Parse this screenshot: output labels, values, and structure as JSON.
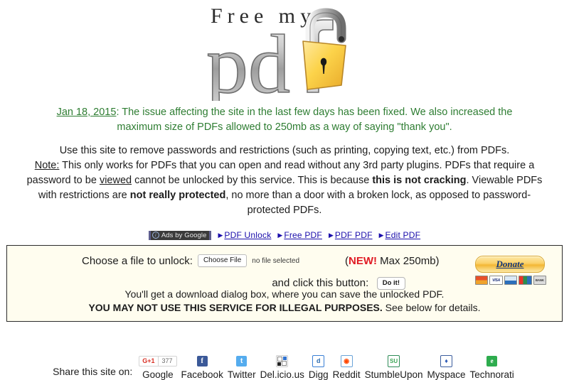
{
  "logo": {
    "line1": "Free my",
    "line2": "pdf",
    "lock_icon": "open-padlock-icon"
  },
  "news": {
    "date": "Jan 18, 2015",
    "text": ": The issue affecting the site in the last few days has been fixed. We also increased the maximum size of PDFs allowed to 250mb as a way of saying \"thank you\".",
    "color": "#2e7d32"
  },
  "intro": {
    "line1": "Use this site to remove passwords and restrictions (such as printing, copying text, etc.) from PDFs.",
    "note_label": "Note:",
    "p2_a": " This only works for PDFs that you can open and read without any 3rd party plugins. PDFs that require a password to be ",
    "p2_viewed": "viewed",
    "p2_b": " cannot be unlocked by this service. This is because ",
    "p2_bold1": "this is not cracking",
    "p2_c": ". Viewable PDFs with restrictions are ",
    "p2_bold2": "not really protected",
    "p2_d": ", no more than a door with a broken lock, as opposed to password-protected PDFs."
  },
  "adbar": {
    "badge_label": "Ads by Google",
    "info_icon": "info-icon",
    "links": [
      {
        "label": "PDF Unlock"
      },
      {
        "label": "Free PDF"
      },
      {
        "label": "PDF PDF"
      },
      {
        "label": "Edit PDF"
      }
    ],
    "link_color": "#1a0dab"
  },
  "form": {
    "choose_label": "Choose a file to unlock:",
    "file_button_label": "Choose File",
    "file_status": "no file selected",
    "max_size_open": "(",
    "max_size_new": "NEW!",
    "max_size_rest": " Max 250mb)",
    "click_label": "and click this button:",
    "submit_label": "Do it!",
    "donate_label": "Donate",
    "cards": [
      {
        "name": "mastercard-icon",
        "label": ""
      },
      {
        "name": "visa-icon",
        "label": "VISA"
      },
      {
        "name": "amex-icon",
        "label": ""
      },
      {
        "name": "discover-icon",
        "label": ""
      },
      {
        "name": "bank-icon",
        "label": "BANK"
      }
    ],
    "note_line1": "You'll get a download dialog box, where you can save the unlocked PDF.",
    "note_bold": "YOU MAY NOT USE THIS SERVICE FOR ILLEGAL PURPOSES.",
    "note_line2_rest": " See below for details.",
    "background": "#fffdef"
  },
  "share": {
    "label": "Share this site on:",
    "gplus": {
      "button_label": "G+1",
      "count": "377",
      "name": "Google"
    },
    "items": [
      {
        "name": "Facebook",
        "icon": "facebook-icon"
      },
      {
        "name": "Twitter",
        "icon": "twitter-icon"
      },
      {
        "name": "Del.icio.us",
        "icon": "delicious-icon"
      },
      {
        "name": "Digg",
        "icon": "digg-icon"
      },
      {
        "name": "Reddit",
        "icon": "reddit-icon"
      },
      {
        "name": "StumbleUpon",
        "icon": "stumbleupon-icon"
      },
      {
        "name": "Myspace",
        "icon": "myspace-icon"
      },
      {
        "name": "Technorati",
        "icon": "technorati-icon"
      }
    ]
  }
}
